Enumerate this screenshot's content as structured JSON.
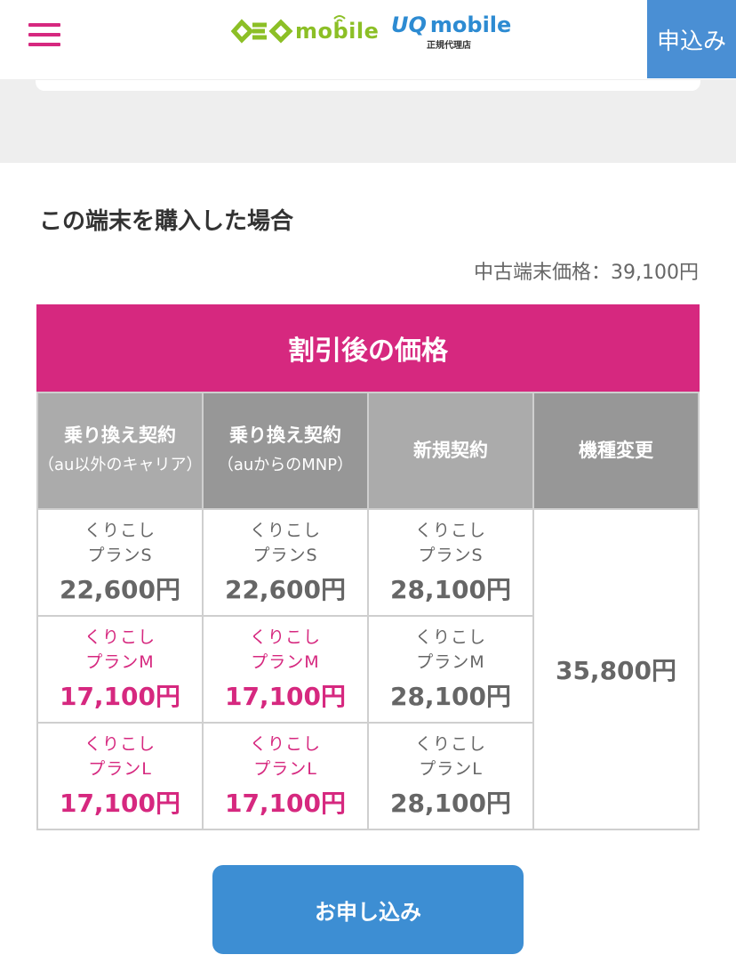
{
  "header": {
    "geo_logo_text": "mobile",
    "uq_logo_main": "UQ",
    "uq_logo_sub_main": "mobile",
    "uq_logo_sub": "正規代理店",
    "apply_label": "申込み"
  },
  "section": {
    "title": "この端末を購入した場合",
    "used_price": "中古端末価格：39,100円"
  },
  "table": {
    "heading": "割引後の価格",
    "columns": [
      {
        "title": "乗り換え契約",
        "note": "（au以外のキャリア）"
      },
      {
        "title": "乗り換え契約",
        "note": "（auからのMNP）"
      },
      {
        "title": "新規契約",
        "note": ""
      },
      {
        "title": "機種変更",
        "note": ""
      }
    ],
    "rows": [
      {
        "cells": [
          {
            "plan": "くりこし",
            "plan2": "プランS",
            "price": "22,600円"
          },
          {
            "plan": "くりこし",
            "plan2": "プランS",
            "price": "22,600円"
          },
          {
            "plan": "くりこし",
            "plan2": "プランS",
            "price": "28,100円"
          }
        ]
      },
      {
        "cells": [
          {
            "plan": "くりこし",
            "plan2": "プランM",
            "price": "17,100円"
          },
          {
            "plan": "くりこし",
            "plan2": "プランM",
            "price": "17,100円"
          },
          {
            "plan": "くりこし",
            "plan2": "プランM",
            "price": "28,100円"
          }
        ]
      },
      {
        "cells": [
          {
            "plan": "くりこし",
            "plan2": "プランL",
            "price": "17,100円"
          },
          {
            "plan": "くりこし",
            "plan2": "プランL",
            "price": "17,100円"
          },
          {
            "plan": "くりこし",
            "plan2": "プランL",
            "price": "28,100円"
          }
        ]
      }
    ],
    "model_change_price": "35,800円"
  },
  "apply_button": "お申し込み",
  "colors": {
    "brand_pink": "#d6287f",
    "brand_blue": "#3d8ed3",
    "geo_green": "#8cbf26"
  }
}
